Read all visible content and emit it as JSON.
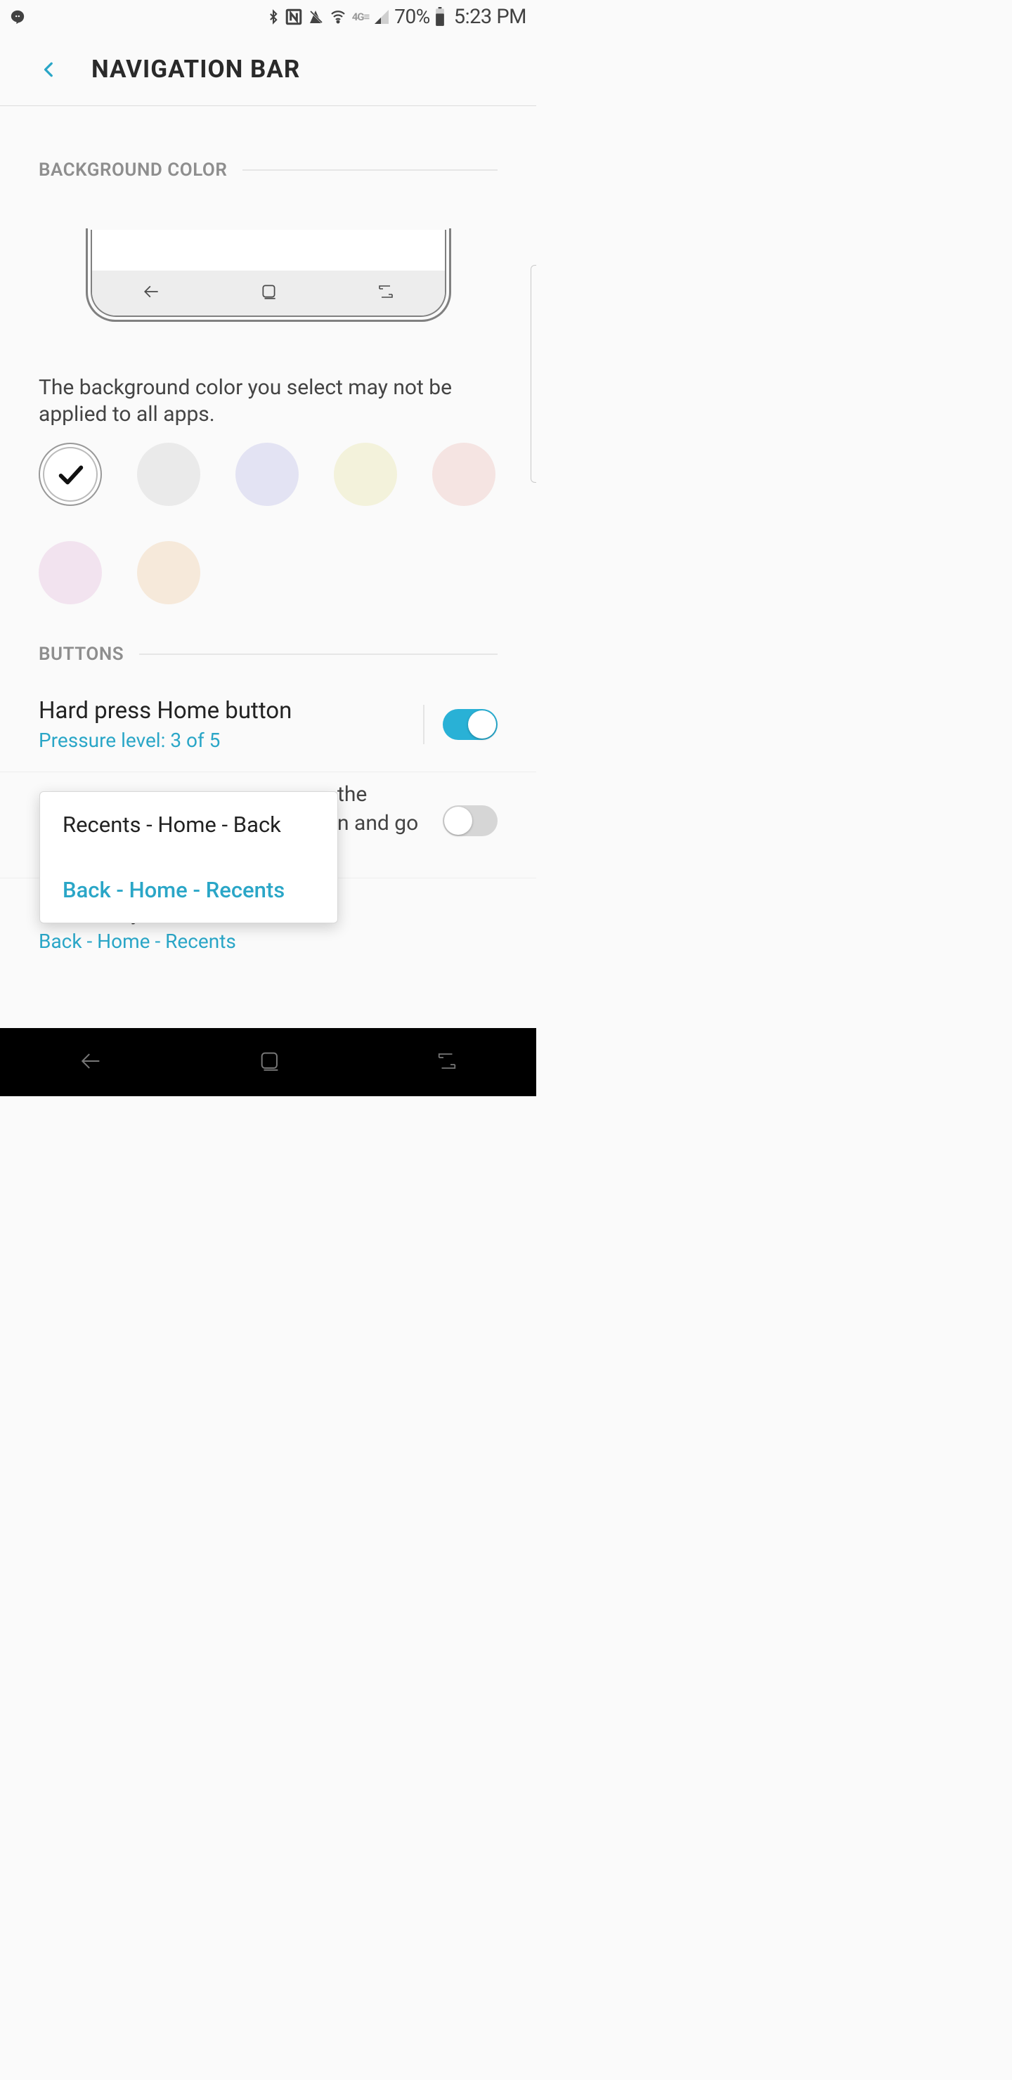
{
  "status": {
    "battery": "70%",
    "time": "5:23 PM",
    "network": "4G"
  },
  "header": {
    "title": "NAVIGATION BAR"
  },
  "sections": {
    "bg_color_label": "BACKGROUND COLOR",
    "buttons_label": "BUTTONS"
  },
  "bg_color": {
    "description": "The background color you select may not be applied to all apps.",
    "swatches": [
      {
        "name": "white",
        "selected": true
      },
      {
        "name": "gray",
        "selected": false
      },
      {
        "name": "lavender",
        "selected": false
      },
      {
        "name": "cream",
        "selected": false
      },
      {
        "name": "pink",
        "selected": false
      },
      {
        "name": "lilac",
        "selected": false
      },
      {
        "name": "peach",
        "selected": false
      }
    ]
  },
  "buttons": {
    "hard_press": {
      "title": "Hard press Home button",
      "subtitle": "Pressure level: 3 of 5",
      "enabled": true
    },
    "unlock": {
      "partial1": "the",
      "partial2": "n and go",
      "enabled": false
    },
    "layout": {
      "title": "Button layout",
      "subtitle": "Back - Home - Recents"
    }
  },
  "popup": {
    "options": [
      {
        "label": "Recents - Home - Back",
        "selected": false
      },
      {
        "label": "Back - Home - Recents",
        "selected": true
      }
    ]
  }
}
